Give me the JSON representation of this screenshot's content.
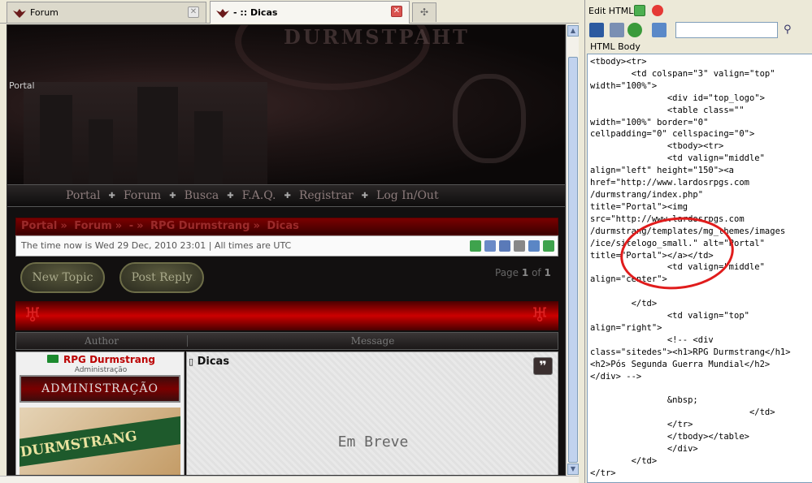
{
  "tabs": [
    {
      "label": "Forum",
      "active": false
    },
    {
      "label": "- :: Dicas",
      "active": true
    }
  ],
  "header": {
    "portal_link": "Portal",
    "crest_text": "DURMSTPAHT"
  },
  "nav": [
    "Portal",
    "Forum",
    "Busca",
    "F.A.Q.",
    "Registrar",
    "Log In/Out"
  ],
  "breadcrumb": [
    "Portal",
    "»",
    "Forum",
    "»",
    "-",
    "»",
    "RPG Durmstrang",
    "»",
    "Dicas"
  ],
  "time_text": "The time now is Wed 29 Dec, 2010 23:01 | All times are UTC",
  "buttons": {
    "new_topic": "New Topic",
    "post_reply": "Post Reply"
  },
  "pagination": {
    "prefix": "Page",
    "current": "1",
    "mid": "of",
    "total": "1"
  },
  "table_head": {
    "author": "Author",
    "message": "Message"
  },
  "post": {
    "author": "RPG Durmstrang",
    "rank": "Administração",
    "badge": "ADMINISTRAÇÃO",
    "avatar_text": "DURMSTRANG",
    "title": "Dicas",
    "body": "Em Breve",
    "quote_label": "❞"
  },
  "pane": {
    "title": "Edit HTML",
    "html_body_label": "HTML Body",
    "search_placeholder": "",
    "code": "<tbody><tr>\n        <td colspan=\"3\" valign=\"top\"\nwidth=\"100%\">\n               <div id=\"top_logo\">\n               <table class=\"\"\nwidth=\"100%\" border=\"0\"\ncellpadding=\"0\" cellspacing=\"0\">\n               <tbody><tr>\n               <td valign=\"middle\"\nalign=\"left\" height=\"150\"><a\nhref=\"http://www.lardosrpgs.com\n/durmstrang/index.php\"\ntitle=\"Portal\"><img\nsrc=\"http://www.lardosrpgs.com\n/durmstrang/templates/mg_themes/images\n/ice/sitelogo_small.\" alt=\"Portal\"\ntitle=\"Portal\"></a></td>\n               <td valign=\"middle\"\nalign=\"center\">\n\n        </td>\n               <td valign=\"top\"\nalign=\"right\">\n               <!-- <div\nclass=\"sitedes\"><h1>RPG Durmstrang</h1>\n<h2>Pós Segunda Guerra Mundial</h2>\n</div> -->\n\n               &nbsp;\n                               </td>\n               </tr>\n               </tbody></table>\n               </div>\n        </td>\n</tr>"
  },
  "colors": {
    "accent_red": "#b00000",
    "annotation": "#e01c1c"
  }
}
